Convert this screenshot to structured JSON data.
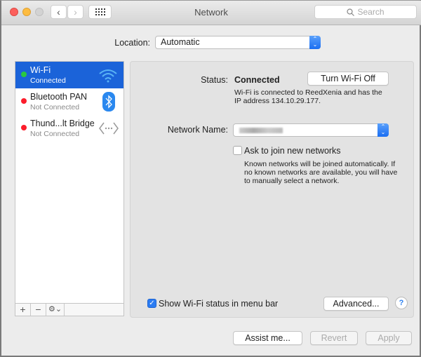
{
  "window": {
    "title": "Network",
    "search_placeholder": "Search"
  },
  "location": {
    "label": "Location:",
    "value": "Automatic"
  },
  "sidebar": {
    "items": [
      {
        "name": "Wi-Fi",
        "status": "Connected",
        "status_color": "#2ac940",
        "selected": true
      },
      {
        "name": "Bluetooth PAN",
        "status": "Not Connected",
        "status_color": "#fc1d2b"
      },
      {
        "name": "Thund...lt Bridge",
        "status": "Not Connected",
        "status_color": "#fc1d2b"
      }
    ],
    "toolbar": {
      "add": "+",
      "remove": "−",
      "gear": "⚙⌄"
    }
  },
  "detail": {
    "status_label": "Status:",
    "status_value": "Connected",
    "turn_off": "Turn Wi-Fi Off",
    "status_desc_1": "Wi-Fi is connected to ReedXenia and has the",
    "status_desc_2": "IP address 134.10.29.177.",
    "network_name_label": "Network Name:",
    "ask_join": "Ask to join new networks",
    "ask_desc_1": "Known networks will be joined automatically. If",
    "ask_desc_2": "no known networks are available, you will have",
    "ask_desc_3": "to manually select a network.",
    "show_status": "Show Wi-Fi status in menu bar",
    "advanced": "Advanced...",
    "help": "?"
  },
  "footer": {
    "assist": "Assist me...",
    "revert": "Revert",
    "apply": "Apply"
  }
}
